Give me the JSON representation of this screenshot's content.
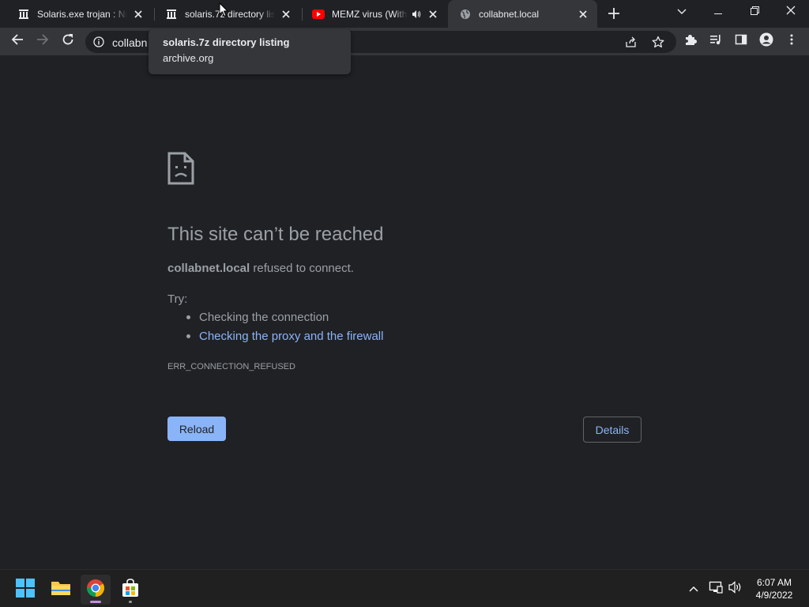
{
  "tabs": [
    {
      "title": "Solaris.exe trojan : Nikita",
      "favicon": "archive-org-icon"
    },
    {
      "title": "solaris.7z directory listing",
      "favicon": "archive-org-icon"
    },
    {
      "title": "MEMZ virus (With",
      "favicon": "youtube-icon",
      "audio": "speaker-icon"
    },
    {
      "title": "collabnet.local",
      "favicon": "globe-icon"
    }
  ],
  "active_tab_index": 3,
  "tooltip": {
    "title": "solaris.7z directory listing",
    "domain": "archive.org"
  },
  "omnibox": {
    "visible_text": "collabn",
    "full_url": "collabnet.local"
  },
  "error_page": {
    "title": "This site can’t be reached",
    "host": "collabnet.local",
    "message": "refused to connect.",
    "try_label": "Try:",
    "suggestions": [
      {
        "text": "Checking the connection",
        "link": false
      },
      {
        "text": "Checking the proxy and the firewall",
        "link": true
      }
    ],
    "error_code": "ERR_CONNECTION_REFUSED",
    "reload_label": "Reload",
    "details_label": "Details"
  },
  "taskbar": {
    "apps": [
      "start-icon",
      "file-explorer-icon",
      "chrome-icon",
      "microsoft-store-icon"
    ],
    "time": "6:07 AM",
    "date": "4/9/2022"
  },
  "colors": {
    "background": "#202124",
    "toolbar": "#35363a",
    "link": "#8ab4f8",
    "text_muted": "#9aa0a6",
    "youtube_red": "#ff0000"
  }
}
